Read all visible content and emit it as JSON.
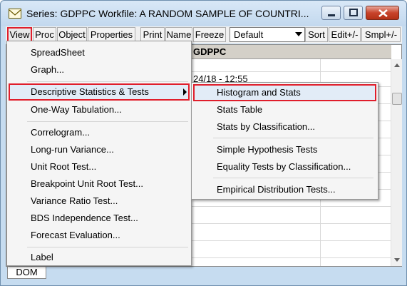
{
  "window": {
    "title": "Series: GDPPC   Workfile: A RANDOM SAMPLE OF COUNTRI..."
  },
  "toolbar": {
    "buttons": [
      "View",
      "Proc",
      "Object",
      "Properties",
      "Print",
      "Name",
      "Freeze",
      "Sort",
      "Edit+/-",
      "Smpl+/-"
    ],
    "dropdown_value": "Default"
  },
  "spreadsheet": {
    "series_name": "GDPPC",
    "last_updated": "24/18 - 12:55"
  },
  "statusbar": {
    "tab_label": "DOM"
  },
  "view_menu": {
    "items": [
      "SpreadSheet",
      "Graph...",
      "Descriptive Statistics & Tests",
      "One-Way Tabulation...",
      "Correlogram...",
      "Long-run Variance...",
      "Unit Root Test...",
      "Breakpoint Unit Root Test...",
      "Variance Ratio Test...",
      "BDS Independence Test...",
      "Forecast Evaluation...",
      "Label"
    ]
  },
  "stats_submenu": {
    "items": [
      "Histogram and Stats",
      "Stats Table",
      "Stats by Classification...",
      "Simple Hypothesis Tests",
      "Equality Tests by Classification...",
      "Empirical Distribution Tests..."
    ]
  },
  "colors": {
    "highlight_border": "#e01e2b",
    "window_frame": "#c6dcf0"
  }
}
